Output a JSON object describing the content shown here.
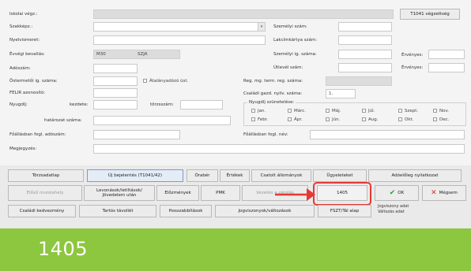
{
  "labels": {
    "school_year": "Iskolai végz.:",
    "vocation": "Szakképz.:",
    "language_exam": "Nyelvismeret:",
    "final_grade": "Évvégi bevallás:",
    "tax_number": "Adószám:",
    "student_card": "Östermetői ig. száma:",
    "felir": "FELIR azonosító:",
    "pension": "Nyugdíj:",
    "pension_start": "kezdete:",
    "pension_reg": "törzsszám:",
    "decision_number": "határozat száma:",
    "main_job": "Főállásban fogl. adószám:",
    "note": "Megjegyzés:",
    "id_number": "Személyi szám:",
    "address_card": "Lakcímkártya szám:",
    "id_card": "Személyi ig. száma:",
    "passport": "Útlevél szám:",
    "valid1": "Érvényes:",
    "valid2": "Érvényes:",
    "reg_term": "Reg. mg. term. reg. száma:",
    "family_farm": "Családi gazd. nyilv. száma:",
    "suspension_group": "Nyugdíj szünetelése:",
    "main_job_name": "Főállásban fogl. név:"
  },
  "fields": {
    "final_grade_value": "M30",
    "final_grade_value2": "SZJA",
    "family_farm_value": "1.",
    "self_employed_checkbox": "Átalányadózó üst."
  },
  "months": [
    "Jan.",
    "Febr.",
    "Márc.",
    "Ápr.",
    "Máj.",
    "Jún.",
    "Júl.",
    "Aug.",
    "Szept.",
    "Okt.",
    "Nov.",
    "Dec."
  ],
  "buttons": {
    "t1041": "T1041 végzettség",
    "master_data": "Törzsadatlap",
    "new_report": "Új bejelentés (T1041/42)",
    "hours": "Órabér",
    "earnings": "Értékek",
    "attached": "Csatolt állományok",
    "documents": "Ügyeleteket",
    "data_change": "Adóelőleg nyilatkozat",
    "prev_employer": "Előző munkahely",
    "deductions": "Levonások/letiltások/ Jövedelem után",
    "previous": "Előzmények",
    "pmk": "PMK",
    "view_disabled": "Vezetés a zárolás",
    "code_1405": "1405",
    "ok": "OK",
    "cancel": "Mégsem",
    "family_discount": "Családi kedvezmény",
    "permanent": "Tartós távollét",
    "extension": "Hosszabbítások",
    "status_changes": "Jogviszonyok/változások",
    "fszt_calc": "FSZT/Tál alap",
    "legal_note1": "Jogviszony adat",
    "legal_note2": "Változás adat"
  },
  "caption": "1405",
  "colors": {
    "caption_bg": "#8dc63f",
    "highlight": "#e53935",
    "ok_check": "#2e9e34",
    "cancel_x": "#d32f2f"
  }
}
